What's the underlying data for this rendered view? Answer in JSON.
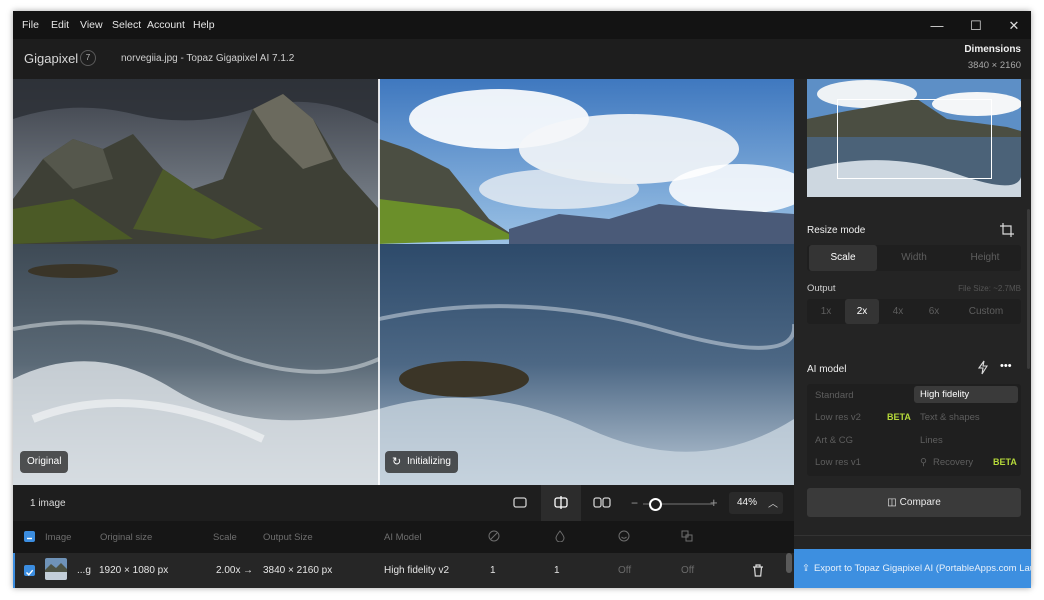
{
  "menu": {
    "file": "File",
    "edit": "Edit",
    "view": "View",
    "select": "Select",
    "account": "Account",
    "help": "Help"
  },
  "window_controls": {
    "minimize": "—",
    "maximize": "☐",
    "close": "✕"
  },
  "app": {
    "brand": "Gigapixel",
    "badge": "7",
    "title": "norvegiia.jpg - Topaz Gigapixel AI 7.1.2"
  },
  "dimensions": {
    "label": "Dimensions",
    "value": "3840 × 2160"
  },
  "preview": {
    "left_label": "Original",
    "right_label": "Initializing",
    "right_icon": "refresh-icon"
  },
  "bottom": {
    "image_count": "1 image",
    "zoom_value": "44%",
    "zoom_level": 0.1
  },
  "list": {
    "headers": {
      "image": "Image",
      "original_size": "Original size",
      "scale": "Scale",
      "output_size": "Output Size",
      "ai_model": "AI Model"
    },
    "header_icons": [
      "target-icon",
      "drop-icon",
      "face-icon",
      "layers-icon"
    ],
    "row": {
      "filename": "...g",
      "original_size": "1920 × 1080 px",
      "scale": "2.00x",
      "arrow": "→",
      "output_size": "3840 × 2160 px",
      "ai_model": "High fidelity v2",
      "col1": "1",
      "col2": "1",
      "col3": "Off",
      "col4": "Off"
    }
  },
  "sidebar": {
    "resize_mode": {
      "title": "Resize mode",
      "tabs": [
        "Scale",
        "Width",
        "Height"
      ],
      "active": "Scale"
    },
    "output": {
      "title": "Output",
      "file_size": "File Size: ~2.7MB",
      "options": [
        "1x",
        "2x",
        "4x",
        "6x",
        "Custom"
      ],
      "active": "2x"
    },
    "ai_model": {
      "title": "AI model",
      "more": "•••",
      "models": [
        {
          "name": "Standard"
        },
        {
          "name": "High fidelity",
          "active": true
        },
        {
          "name": "Low res v2",
          "beta": "BETA"
        },
        {
          "name": "Text & shapes"
        },
        {
          "name": "Art & CG"
        },
        {
          "name": "Lines"
        },
        {
          "name": "Low res v1"
        },
        {
          "name": "Recovery",
          "beta": "BETA"
        }
      ]
    },
    "compare_label": "Compare",
    "export_label": "Export to Topaz Gigapixel AI (PortableApps.com Launcher)"
  },
  "colors": {
    "accent": "#3d8fe0",
    "beta": "#b5d93a",
    "background": "#161616",
    "panel": "#242424"
  }
}
